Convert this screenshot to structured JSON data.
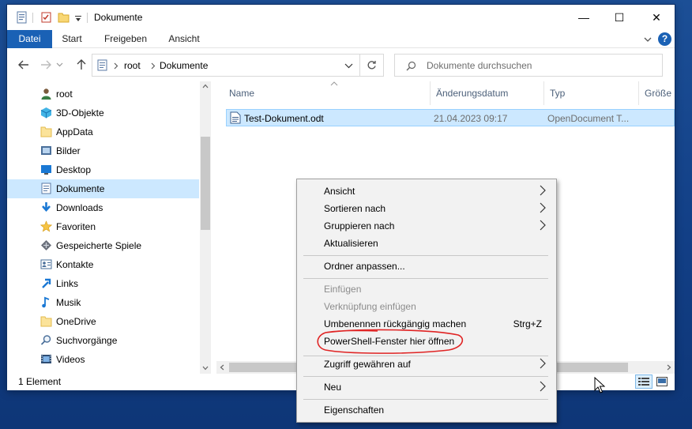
{
  "window": {
    "title": "Dokumente",
    "controls": {
      "minimize": "—",
      "maximize": "☐",
      "close": "✕"
    }
  },
  "ribbon": {
    "tabs": [
      "Datei",
      "Start",
      "Freigeben",
      "Ansicht"
    ],
    "help": "?"
  },
  "address": {
    "crumbs": [
      "root",
      "Dokumente"
    ],
    "search_placeholder": "Dokumente durchsuchen"
  },
  "nav": {
    "items": [
      {
        "label": "root",
        "icon": "user-icon"
      },
      {
        "label": "3D-Objekte",
        "icon": "3d-objects-icon"
      },
      {
        "label": "AppData",
        "icon": "folder-icon"
      },
      {
        "label": "Bilder",
        "icon": "pictures-icon"
      },
      {
        "label": "Desktop",
        "icon": "desktop-icon"
      },
      {
        "label": "Dokumente",
        "icon": "documents-icon"
      },
      {
        "label": "Downloads",
        "icon": "download-icon"
      },
      {
        "label": "Favoriten",
        "icon": "star-icon"
      },
      {
        "label": "Gespeicherte Spiele",
        "icon": "games-icon"
      },
      {
        "label": "Kontakte",
        "icon": "contacts-icon"
      },
      {
        "label": "Links",
        "icon": "links-icon"
      },
      {
        "label": "Musik",
        "icon": "music-icon"
      },
      {
        "label": "OneDrive",
        "icon": "folder-icon"
      },
      {
        "label": "Suchvorgänge",
        "icon": "search-icon"
      },
      {
        "label": "Videos",
        "icon": "videos-icon"
      }
    ],
    "selected": "Dokumente"
  },
  "columns": {
    "name": "Name",
    "date": "Änderungsdatum",
    "type": "Typ",
    "size": "Größe"
  },
  "files": [
    {
      "name": "Test-Dokument.odt",
      "date": "21.04.2023 09:17",
      "type": "OpenDocument T..."
    }
  ],
  "status": {
    "count": "1 Element"
  },
  "context_menu": {
    "items": [
      {
        "label": "Ansicht",
        "submenu": true
      },
      {
        "label": "Sortieren nach",
        "submenu": true
      },
      {
        "label": "Gruppieren nach",
        "submenu": true
      },
      {
        "label": "Aktualisieren"
      },
      {
        "label": "Ordner anpassen..."
      },
      {
        "label": "Einfügen",
        "disabled": true
      },
      {
        "label": "Verknüpfung einfügen",
        "disabled": true
      },
      {
        "label": "Umbenennen rückgängig machen",
        "shortcut": "Strg+Z"
      },
      {
        "label": "PowerShell-Fenster hier öffnen",
        "highlighted_annotation": true
      },
      {
        "label": "Zugriff gewähren auf",
        "submenu": true
      },
      {
        "label": "Neu",
        "submenu": true
      },
      {
        "label": "Eigenschaften"
      }
    ]
  },
  "colors": {
    "accent": "#1a61b5",
    "selection": "#cce8ff",
    "annotation": "#e02424"
  }
}
